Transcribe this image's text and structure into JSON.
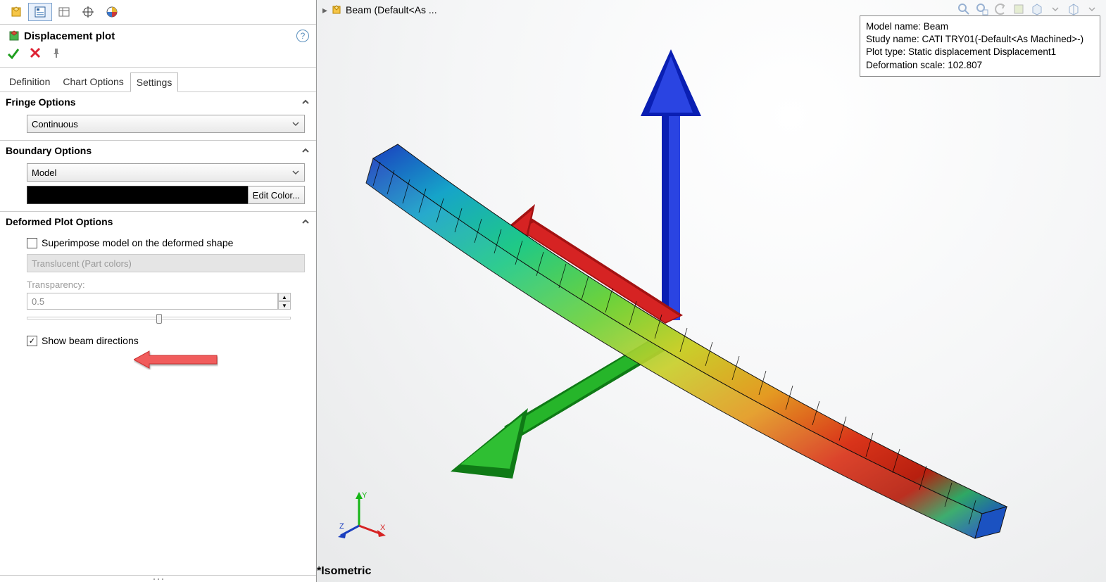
{
  "panel": {
    "title": "Displacement plot",
    "tabs": [
      "Definition",
      "Chart Options",
      "Settings"
    ],
    "activeTab": 2,
    "fringe": {
      "title": "Fringe Options",
      "value": "Continuous"
    },
    "boundary": {
      "title": "Boundary Options",
      "value": "Model",
      "edit": "Edit Color..."
    },
    "deformed": {
      "title": "Deformed Plot Options",
      "superimpose": "Superimpose model on the deformed shape",
      "translucent": "Translucent (Part colors)",
      "transLabel": "Transparency:",
      "transValue": "0.5",
      "showBeam": "Show beam directions"
    }
  },
  "canvas": {
    "breadcrumb": "Beam  (Default<As ...",
    "iso": "*Isometric",
    "triad": {
      "x": "X",
      "y": "Y",
      "z": "Z"
    },
    "info": {
      "l1": "Model name: Beam",
      "l2": "Study name: CATI TRY01(-Default<As Machined>-)",
      "l3": "Plot type: Static displacement Displacement1",
      "l4": "Deformation scale: 102.807"
    }
  }
}
